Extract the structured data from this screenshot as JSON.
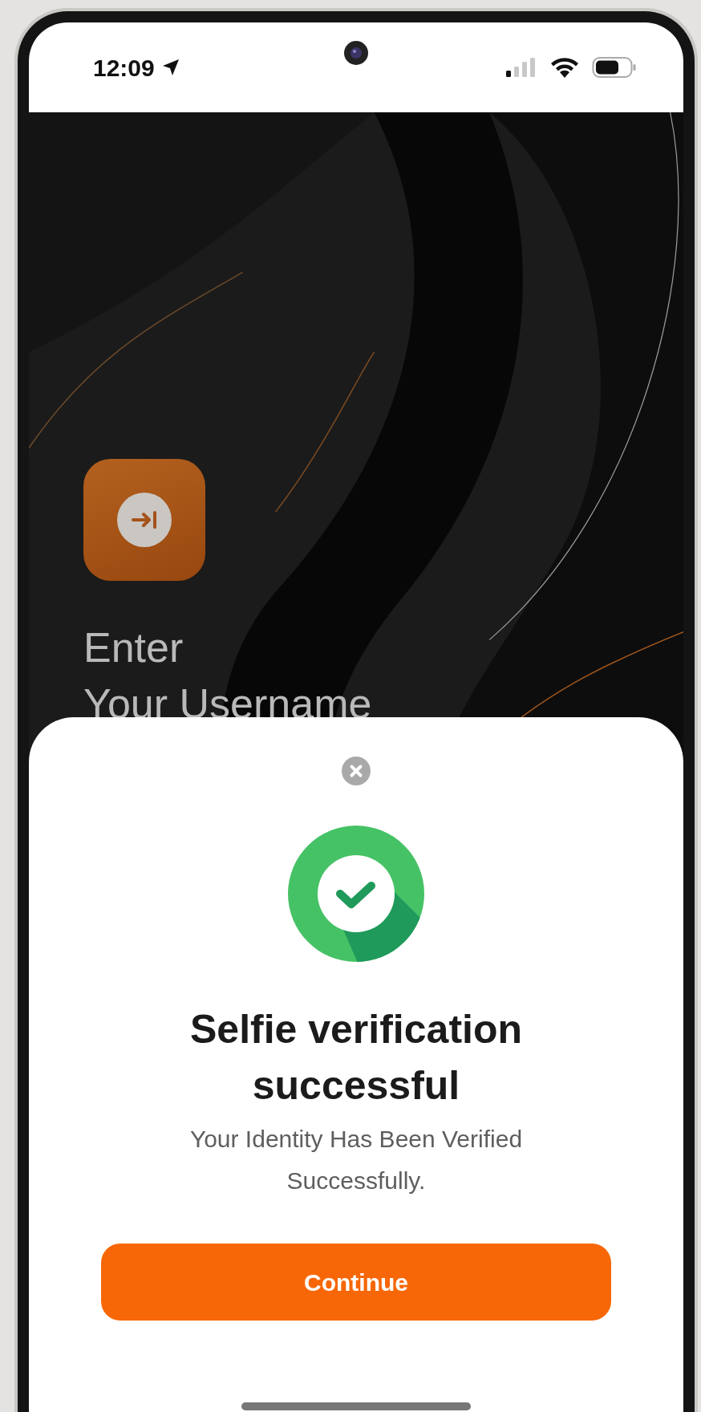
{
  "status_bar": {
    "time": "12:09"
  },
  "screen": {
    "heading_lines": [
      "Enter",
      "Your Username"
    ]
  },
  "sheet": {
    "title": "Selfie verification successful",
    "message": "Your Identity Has Been Verified Successfully.",
    "button": "Continue"
  }
}
